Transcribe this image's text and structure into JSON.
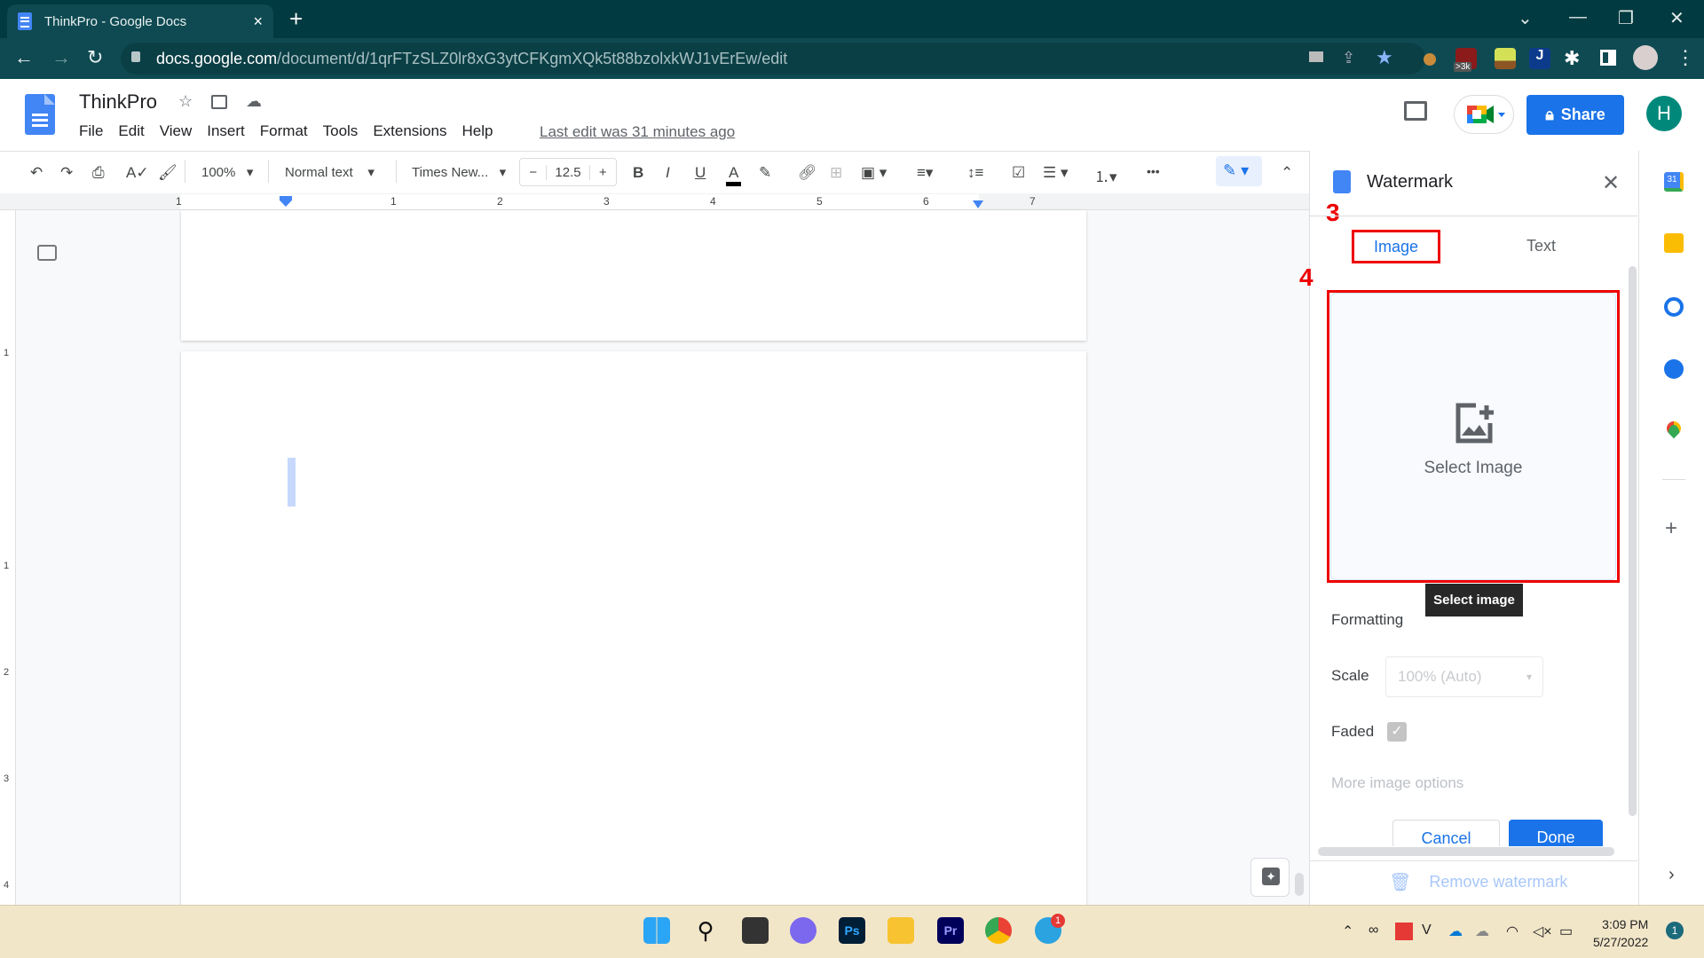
{
  "browser": {
    "tab_title": "ThinkPro - Google Docs",
    "tab_close": "×",
    "new_tab": "+",
    "url_host": "docs.google.com",
    "url_path": "/document/d/1qrFTzSLZ0lr8xG3ytCFKgmXQk5t88bzolxkWJ1vErEw/edit",
    "extension_badge": ">3k",
    "window_controls": {
      "dropdown": "⌄",
      "minimize": "—",
      "restore": "❐",
      "close": "✕"
    },
    "nav": {
      "back": "←",
      "forward": "→",
      "reload": "↻",
      "menu": "⋮"
    }
  },
  "docs": {
    "title": "ThinkPro",
    "menus": [
      "File",
      "Edit",
      "View",
      "Insert",
      "Format",
      "Tools",
      "Extensions",
      "Help"
    ],
    "last_edit": "Last edit was 31 minutes ago",
    "share_label": "Share",
    "account_initial": "H"
  },
  "toolbar": {
    "zoom": "100%",
    "style": "Normal text",
    "font": "Times New...",
    "font_size": "12.5",
    "minus": "−",
    "plus": "+",
    "bold": "B",
    "italic": "I",
    "underline": "U",
    "text_color": "A",
    "more": "•••"
  },
  "ruler": {
    "labels": [
      "1",
      "1",
      "2",
      "3",
      "4",
      "5",
      "6",
      "7"
    ],
    "vertical_labels": [
      "1",
      "1",
      "2",
      "3",
      "4"
    ]
  },
  "watermark_panel": {
    "title": "Watermark",
    "tabs": [
      {
        "label": "Image",
        "active": true
      },
      {
        "label": "Text",
        "active": false
      }
    ],
    "select_image_label": "Select Image",
    "tooltip": "Select image",
    "formatting_heading": "Formatting",
    "scale_label": "Scale",
    "scale_value": "100% (Auto)",
    "faded_label": "Faded",
    "faded_checked": true,
    "more_options": "More image options",
    "cancel_label": "Cancel",
    "done_label": "Done",
    "remove_label": "Remove watermark",
    "annotations": [
      "3",
      "4"
    ]
  },
  "taskbar": {
    "apps": [
      "Start",
      "Search",
      "Task View",
      "Meet",
      "Ps",
      "File Explorer",
      "Pr",
      "Chrome",
      "Telegram"
    ],
    "telegram_badge": "1",
    "time": "3:09 PM",
    "date": "5/27/2022",
    "notifications": "1"
  },
  "colors": {
    "accent": "#1a73e8",
    "annotation": "#ee0000",
    "chrome_bg": "#013a40"
  }
}
